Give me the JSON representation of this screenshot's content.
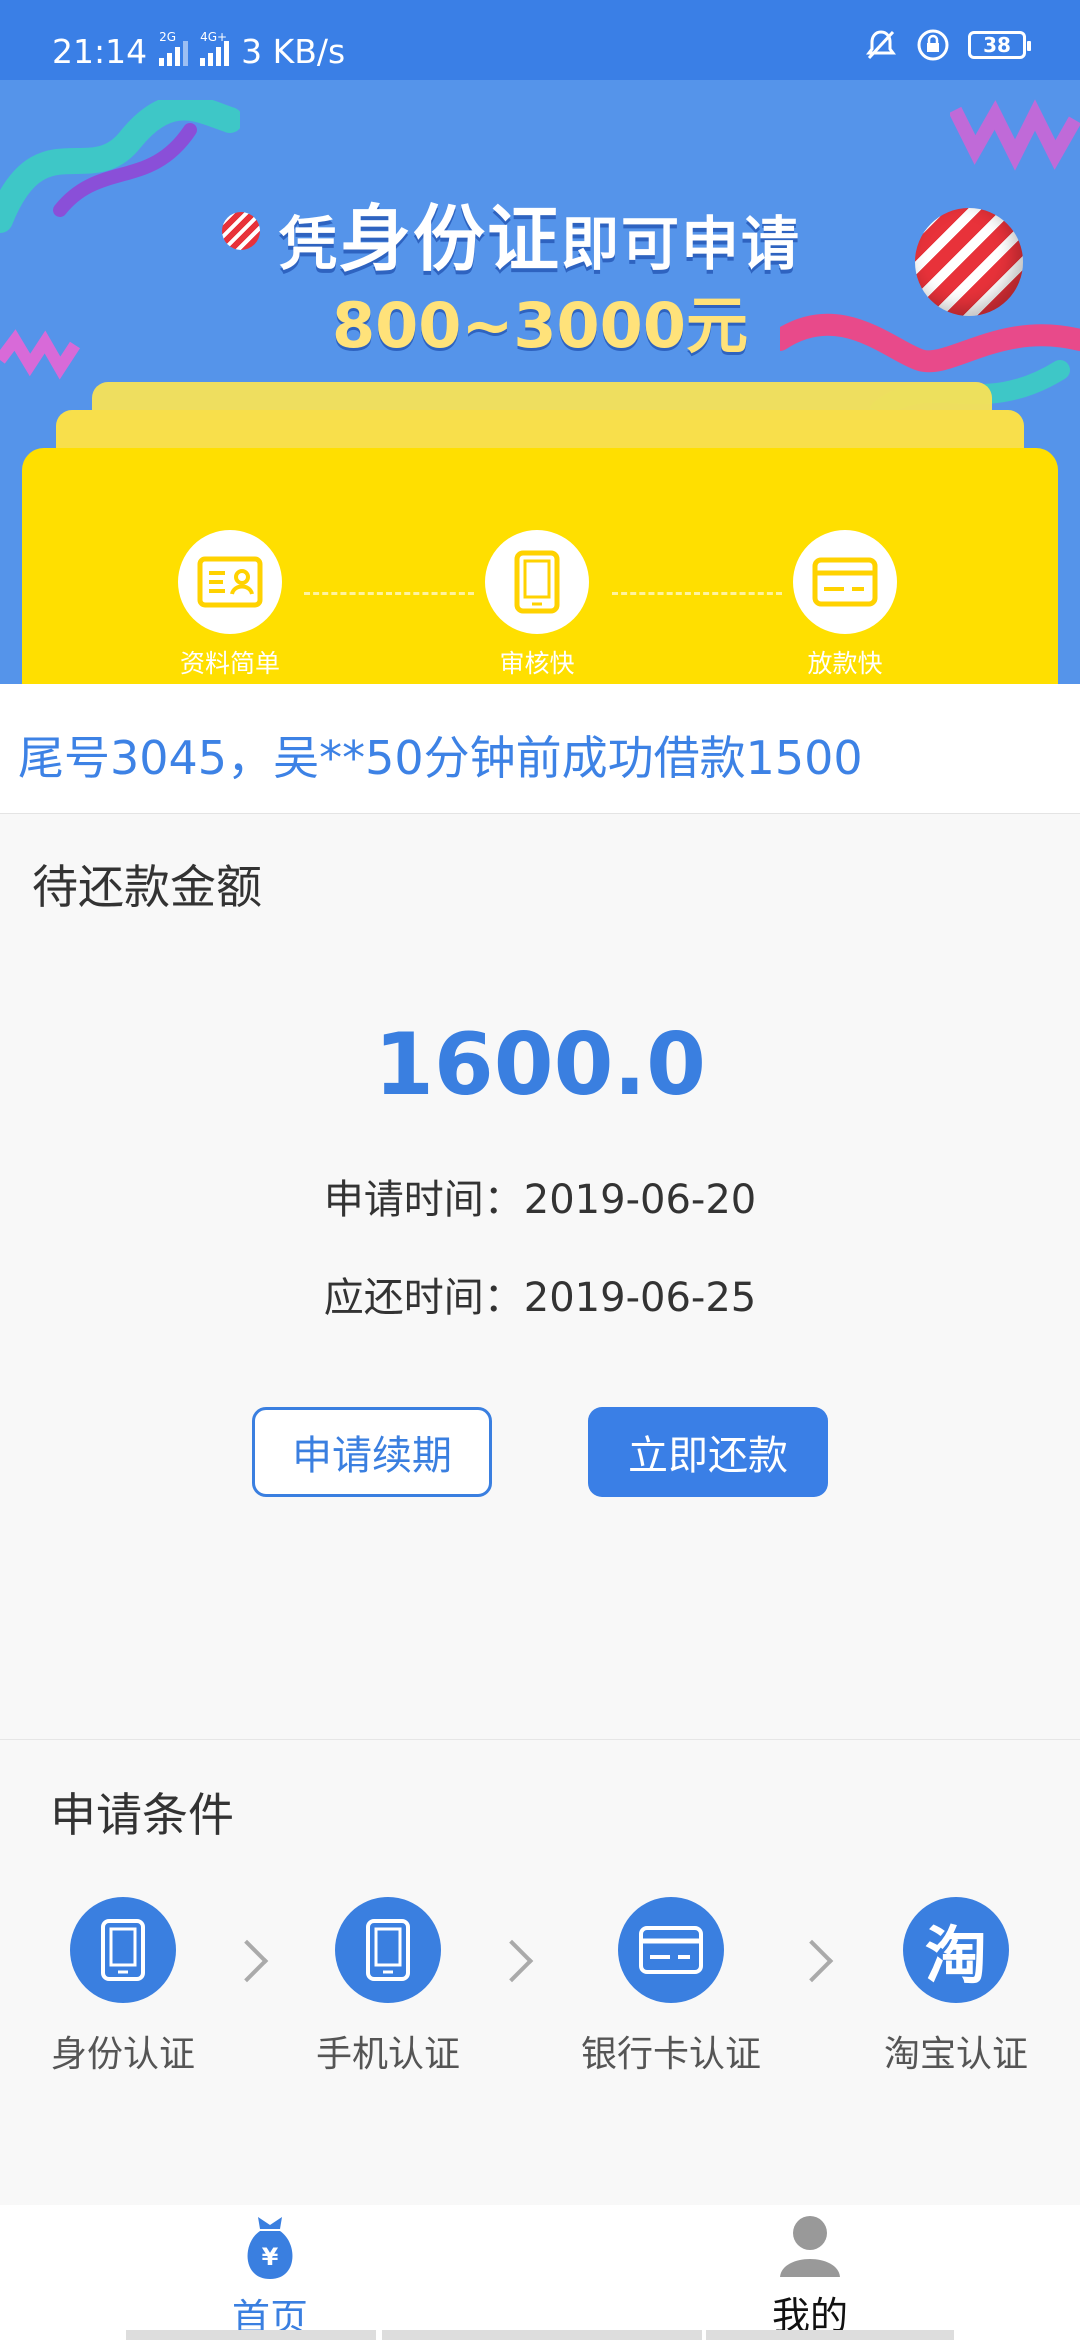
{
  "status_bar": {
    "time": "21:14",
    "net_2g": "2G",
    "net_4g": "4G+",
    "speed": "3 KB/s",
    "battery": "38"
  },
  "banner": {
    "title_prefix": "凭",
    "title_main": "身份证",
    "title_suffix": "即可申请",
    "amount_range": "800~3000元",
    "steps": [
      {
        "label": "资料简单",
        "icon": "id-card-icon"
      },
      {
        "label": "审核快",
        "icon": "phone-icon"
      },
      {
        "label": "放款快",
        "icon": "bank-card-icon"
      }
    ]
  },
  "notice": {
    "text": "尾号3045，吴**50分钟前成功借款1500"
  },
  "repay": {
    "title": "待还款金额",
    "amount": "1600.0",
    "apply_time_label": "申请时间：",
    "apply_time": "2019-06-20",
    "due_time_label": "应还时间：",
    "due_time": "2019-06-25",
    "extend_button": "申请续期",
    "repay_button": "立即还款",
    "accent": "#3a7fe0"
  },
  "conditions": {
    "title": "申请条件",
    "items": [
      {
        "label": "身份认证",
        "icon": "phone-icon"
      },
      {
        "label": "手机认证",
        "icon": "phone-icon"
      },
      {
        "label": "银行卡认证",
        "icon": "bank-card-icon"
      },
      {
        "label": "淘宝认证",
        "icon": "taobao-icon",
        "glyph": "淘"
      }
    ]
  },
  "tabbar": {
    "tabs": [
      {
        "label": "首页",
        "icon": "money-bag-icon",
        "active": true,
        "glyph": "¥"
      },
      {
        "label": "我的",
        "icon": "user-icon",
        "active": false
      }
    ],
    "active_color": "#3a7fe0"
  }
}
